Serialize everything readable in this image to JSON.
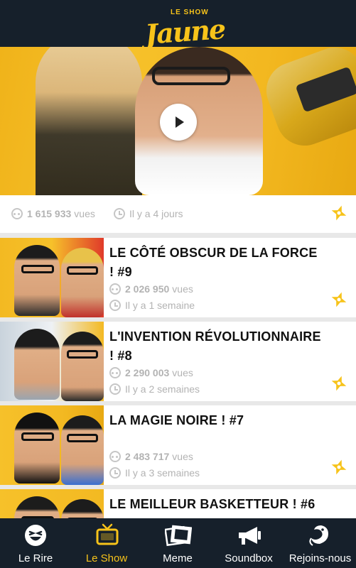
{
  "header": {
    "logo_small": "LE SHOW",
    "logo_big": "Jaune"
  },
  "featured": {
    "views_number": "1 615 933",
    "views_suffix": "vues",
    "time": "Il y a 4 jours"
  },
  "videos": [
    {
      "title": "LE CÔTÉ OBSCUR DE LA FORCE !  #9",
      "views_number": "2 026 950",
      "views_suffix": "vues",
      "time": "Il y a 1 semaine"
    },
    {
      "title": "L'INVENTION RÉVOLUTIONNAIRE !  #8",
      "views_number": "2 290 003",
      "views_suffix": "vues",
      "time": "Il y a 2 semaines"
    },
    {
      "title": "LA MAGIE NOIRE !  #7",
      "views_number": "2 483 717",
      "views_suffix": "vues",
      "time": "Il y a 3 semaines"
    },
    {
      "title": "LE MEILLEUR BASKETTEUR !  #6",
      "views_number": "",
      "views_suffix": "",
      "time": ""
    }
  ],
  "bottom_nav": {
    "items": [
      {
        "label": "Le Rire",
        "icon": "laughing-face-icon"
      },
      {
        "label": "Le Show",
        "icon": "tv-icon"
      },
      {
        "label": "Meme",
        "icon": "photos-icon"
      },
      {
        "label": "Soundbox",
        "icon": "megaphone-icon"
      },
      {
        "label": "Rejoins-nous",
        "icon": "dragon-icon"
      }
    ],
    "active_index": 1
  },
  "colors": {
    "header_bg": "#16202b",
    "accent_yellow": "#f7c31a",
    "meta_grey": "#b3b3b3"
  }
}
